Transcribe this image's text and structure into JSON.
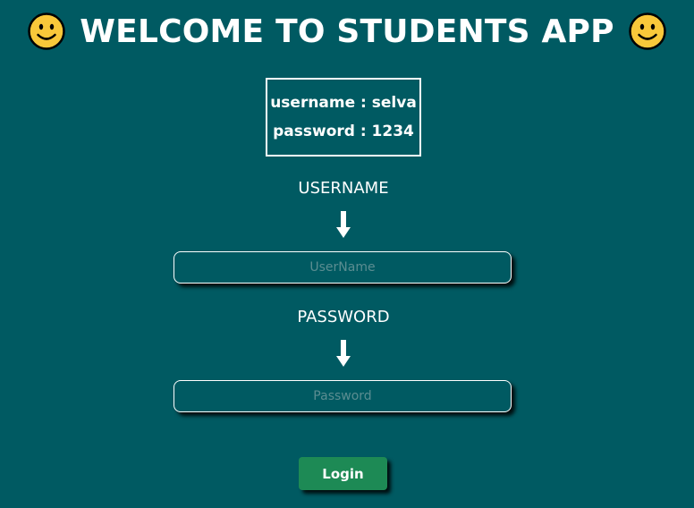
{
  "header": {
    "title": "WELCOME TO STUDENTS APP",
    "left_icon": "smiley-face-icon",
    "right_icon": "smiley-face-icon"
  },
  "credentials_hint": {
    "username_line": "username : selva",
    "password_line": "password : 1234"
  },
  "form": {
    "username_label": "USERNAME",
    "username_arrow_icon": "down-arrow-icon",
    "username_placeholder": "UserName",
    "username_value": "",
    "password_label": "PASSWORD",
    "password_arrow_icon": "down-arrow-icon",
    "password_placeholder": "Password",
    "password_value": "",
    "login_label": "Login"
  },
  "colors": {
    "background": "#005a62",
    "text": "#ffffff",
    "login_button": "#1d8a55",
    "smiley_face": "#f9c83a",
    "placeholder": "#5b8d91"
  }
}
